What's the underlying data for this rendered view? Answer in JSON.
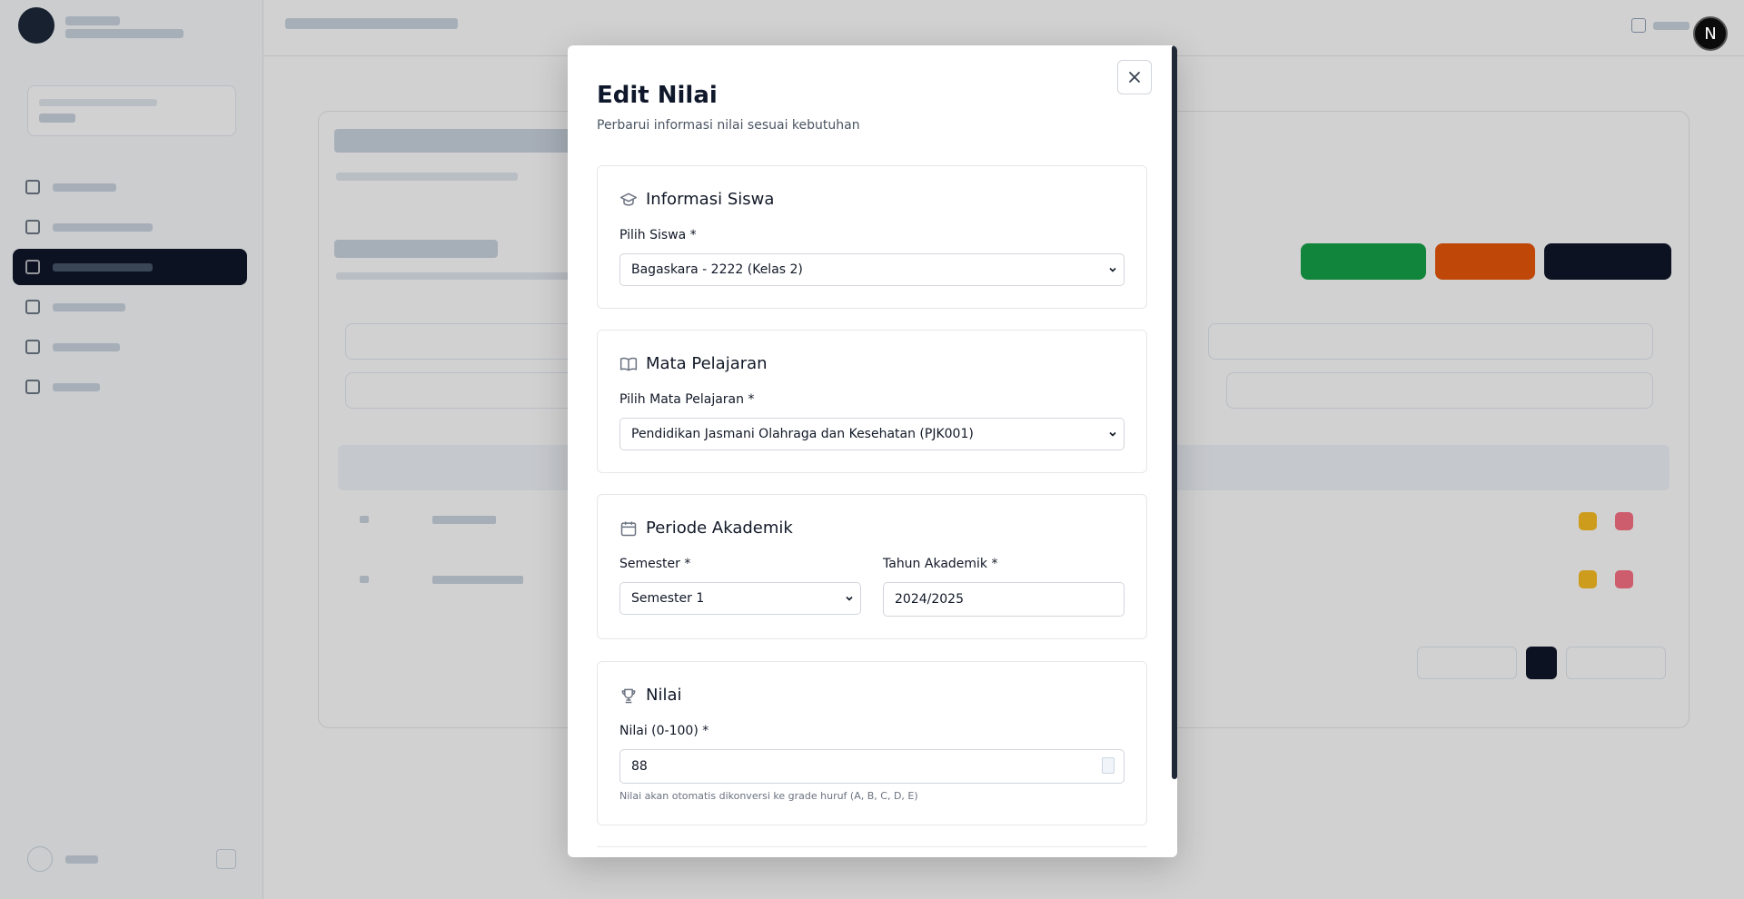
{
  "modal": {
    "title": "Edit Nilai",
    "description": "Perbarui informasi nilai sesuai kebutuhan",
    "sections": {
      "student": {
        "title": "Informasi Siswa",
        "icon": "graduation-cap-icon",
        "label": "Pilih Siswa *",
        "value": "Bagaskara - 2222 (Kelas 2)"
      },
      "subject": {
        "title": "Mata Pelajaran",
        "icon": "book-open-icon",
        "label": "Pilih Mata Pelajaran *",
        "value": "Pendidikan Jasmani Olahraga dan Kesehatan (PJK001)"
      },
      "period": {
        "title": "Periode Akademik",
        "icon": "calendar-icon",
        "semester_label": "Semester *",
        "semester_value": "Semester 1",
        "year_label": "Tahun Akademik *",
        "year_value": "2024/2025"
      },
      "grade": {
        "title": "Nilai",
        "icon": "trophy-icon",
        "label": "Nilai (0-100) *",
        "value": "88",
        "hint": "Nilai akan otomatis dikonversi ke grade huruf (A, B, C, D, E)"
      }
    }
  },
  "topbar": {
    "avatar_letter": "N"
  },
  "colors": {
    "overlay": "rgba(0,0,0,0.18)",
    "primary": "#0f172a",
    "green": "#16a34a",
    "orange": "#ea580c"
  }
}
